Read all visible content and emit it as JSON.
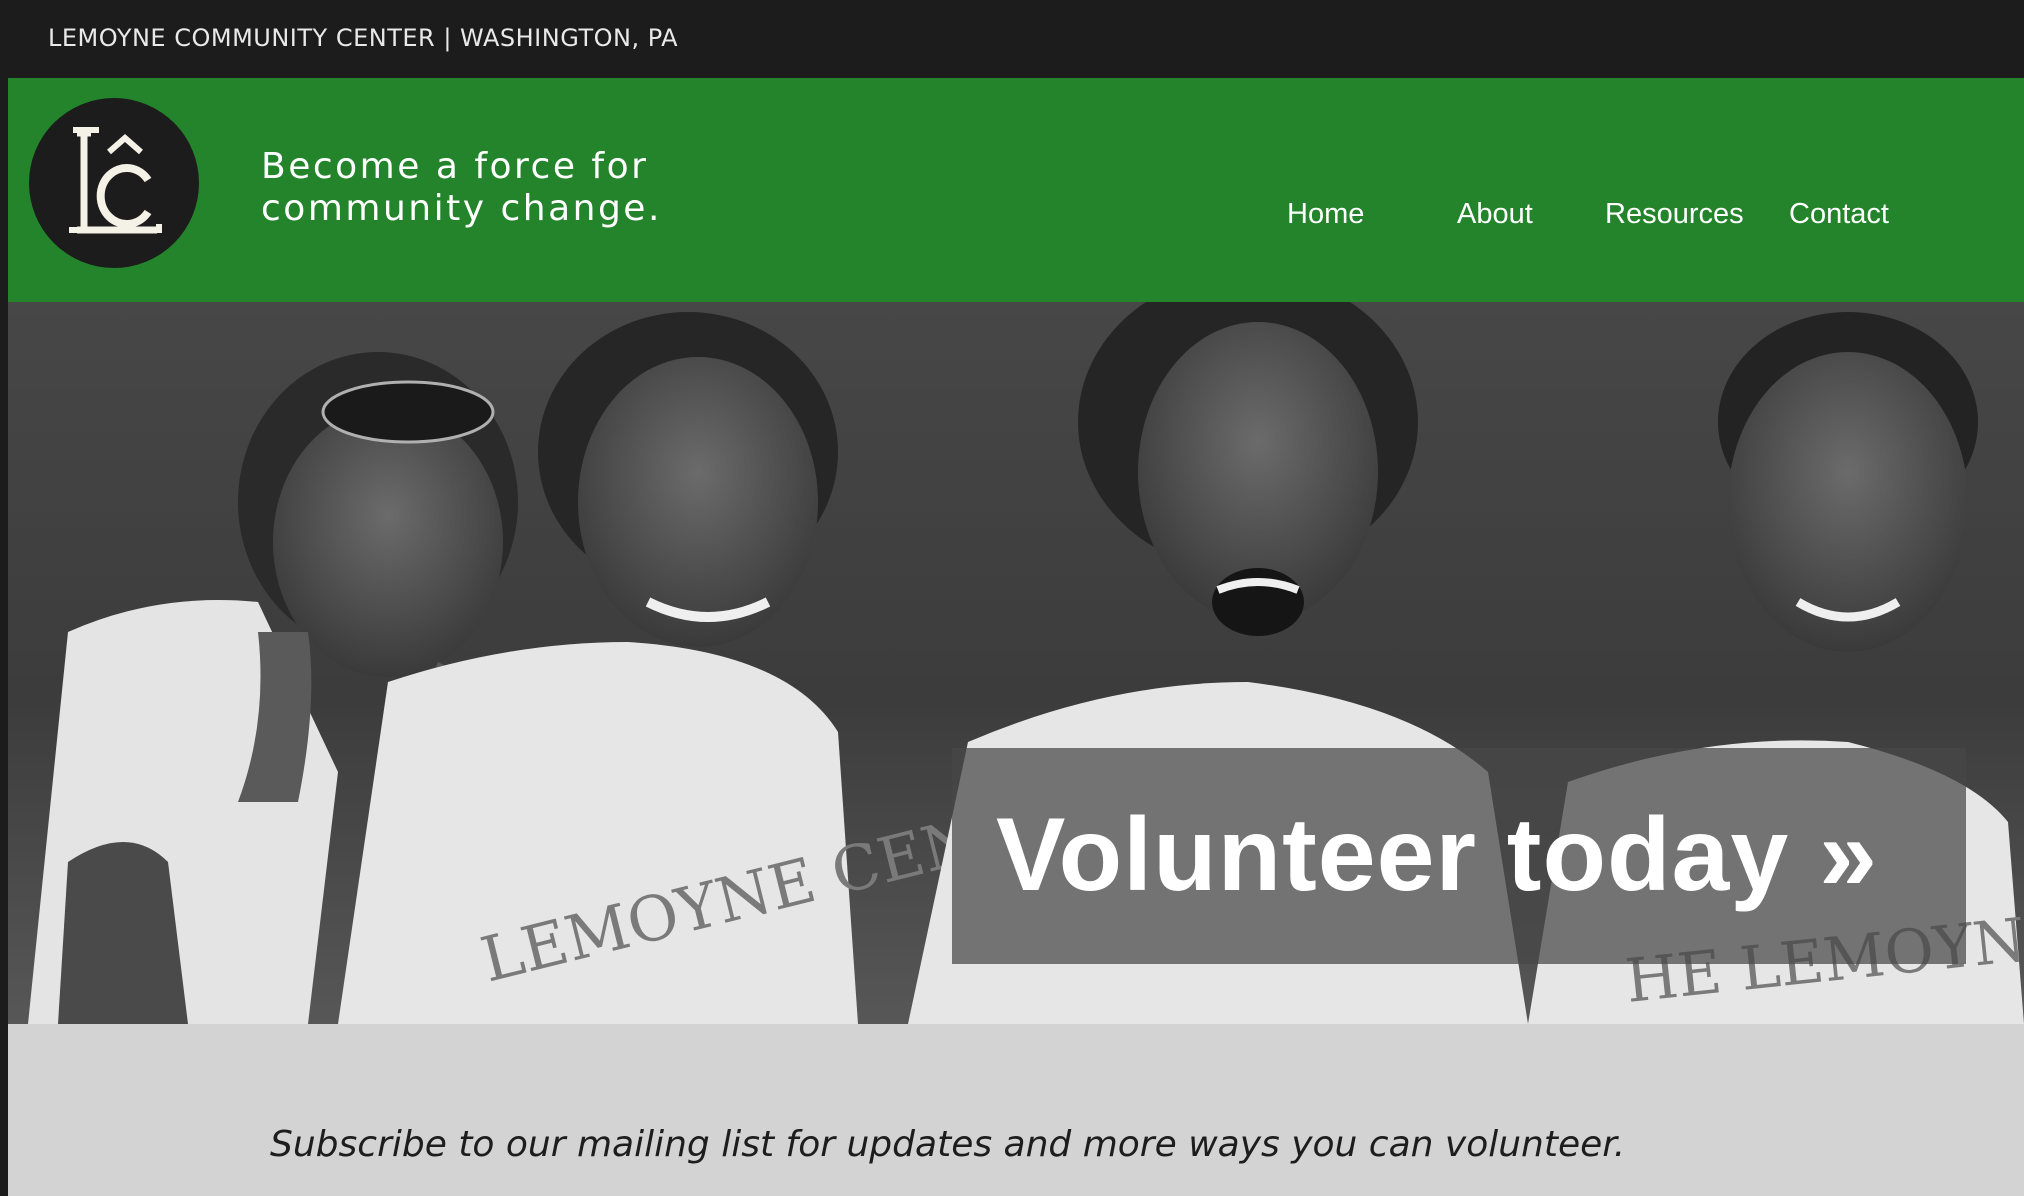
{
  "topbar": {
    "site_label": "LEMOYNE COMMUNITY CENTER | WASHINGTON, PA"
  },
  "header": {
    "logo_icon": "lc-monogram-icon",
    "tagline_line1": "Become a force for",
    "tagline_line2": "community change.",
    "nav": [
      {
        "label": "Home"
      },
      {
        "label": "About"
      },
      {
        "label": "Resources"
      },
      {
        "label": "Contact"
      }
    ]
  },
  "hero": {
    "cta_label": "Volunteer today »"
  },
  "subscribe": {
    "text": "Subscribe to our mailing list for updates and more ways you can volunteer."
  },
  "colors": {
    "topbar_bg": "#1c1c1c",
    "header_green": "#23842b",
    "subscribe_bg": "#d3d3d3"
  }
}
